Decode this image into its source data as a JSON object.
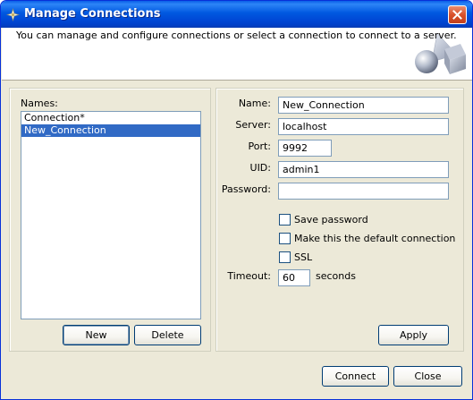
{
  "window": {
    "title": "Manage Connections"
  },
  "header": {
    "description": "You can manage and configure connections or select a connection to connect to a server."
  },
  "names_panel": {
    "label": "Names:",
    "items": [
      {
        "label": "Connection*",
        "selected": false
      },
      {
        "label": "New_Connection",
        "selected": true
      }
    ],
    "new_label": "New",
    "delete_label": "Delete"
  },
  "form": {
    "name_label": "Name:",
    "name_value": "New_Connection",
    "server_label": "Server:",
    "server_value": "localhost",
    "port_label": "Port:",
    "port_value": "9992",
    "uid_label": "UID:",
    "uid_value": "admin1",
    "password_label": "Password:",
    "password_value": "",
    "save_password_label": "Save password",
    "save_password_checked": false,
    "default_label": "Make this the default connection",
    "default_checked": false,
    "ssl_label": "SSL",
    "ssl_checked": false,
    "timeout_label": "Timeout:",
    "timeout_value": "60",
    "timeout_unit": "seconds",
    "apply_label": "Apply"
  },
  "footer": {
    "connect_label": "Connect",
    "close_label": "Close"
  },
  "icons": {
    "title": "app-icon",
    "close": "close-icon",
    "header": "shapes-graphic-icon"
  },
  "colors": {
    "titlebar": "#0058e0",
    "selection": "#316ac5",
    "close_button": "#d9512c",
    "dialog_bg": "#ece9d8"
  }
}
